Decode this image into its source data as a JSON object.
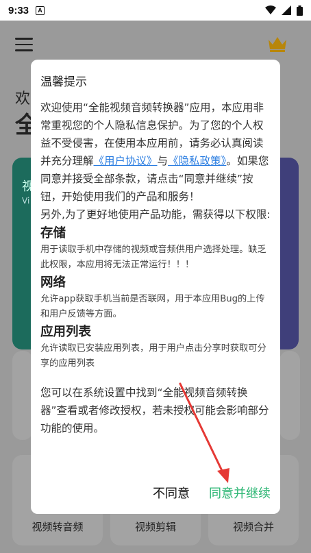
{
  "status_bar": {
    "time": "9:33",
    "app_icon_letter": "A"
  },
  "app": {
    "greet_partial": "欢",
    "title_partial": "全",
    "card_left_partial": "视",
    "card_left_sub_partial": "Vi",
    "bottom_items": [
      "视频转音频",
      "视频剪辑",
      "视频合并"
    ]
  },
  "dialog": {
    "title": "温馨提示",
    "intro_before_links": "欢迎使用“全能视频音频转换器”应用，本应用非常重视您的个人隐私信息保护。为了您的个人权益不受侵害，在使用本应用前，请务必认真阅读并充分理解",
    "link_user_agreement": "《用户协议》",
    "and": "与",
    "link_privacy_policy": "《隐私政策》",
    "intro_after_links": "。如果您同意并接受全部条款，请点击“同意并继续”按钮，开始使用我们的产品和服务！",
    "extra": "另外,为了更好地使用产品功能，需获得以下权限:",
    "permissions": [
      {
        "title": "存储",
        "desc": "用于读取手机中存储的视频或音频供用户选择处理。缺乏此权限，本应用将无法正常运行！！！"
      },
      {
        "title": "网络",
        "desc": "允许app获取手机当前是否联网，用于本应用Bug的上传和用户反馈等方面。"
      },
      {
        "title": "应用列表",
        "desc": "允许读取已安装应用列表，用于用户点击分享时获取可分享的应用列表"
      }
    ],
    "footer": "您可以在系统设置中找到“全能视频音频转换器”查看或者修改授权，若未授权可能会影响部分功能的使用。",
    "disagree_label": "不同意",
    "agree_label": "同意并继续"
  },
  "colors": {
    "agree": "#2bb673",
    "link": "#2a7de1",
    "arrow": "#e53935"
  }
}
